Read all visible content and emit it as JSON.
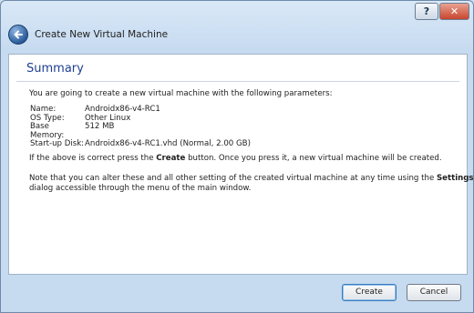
{
  "titlebar": {
    "help_label": "?",
    "close_label": "✕"
  },
  "header": {
    "title": "Create New Virtual Machine"
  },
  "summary": {
    "title": "Summary",
    "intro": "You are going to create a new virtual machine with the following parameters:",
    "params": [
      {
        "key": "Name:",
        "value": "Androidx86-v4-RC1"
      },
      {
        "key": "OS Type:",
        "value": "Other Linux"
      },
      {
        "key": "Base Memory:",
        "value": "512 MB"
      },
      {
        "key": "Start-up Disk:",
        "value": "Androidx86-v4-RC1.vhd (Normal, 2.00 GB)"
      }
    ],
    "create_note": {
      "before": "If the above is correct press the ",
      "bold": "Create",
      "after": " button. Once you press it, a new virtual machine will be created."
    },
    "settings_note": {
      "before": "Note that you can alter these and all other setting of the created virtual machine at any time using the ",
      "bold": "Settings",
      "line2": "dialog accessible through the menu of the main window."
    }
  },
  "buttons": {
    "create": "Create",
    "cancel": "Cancel"
  }
}
